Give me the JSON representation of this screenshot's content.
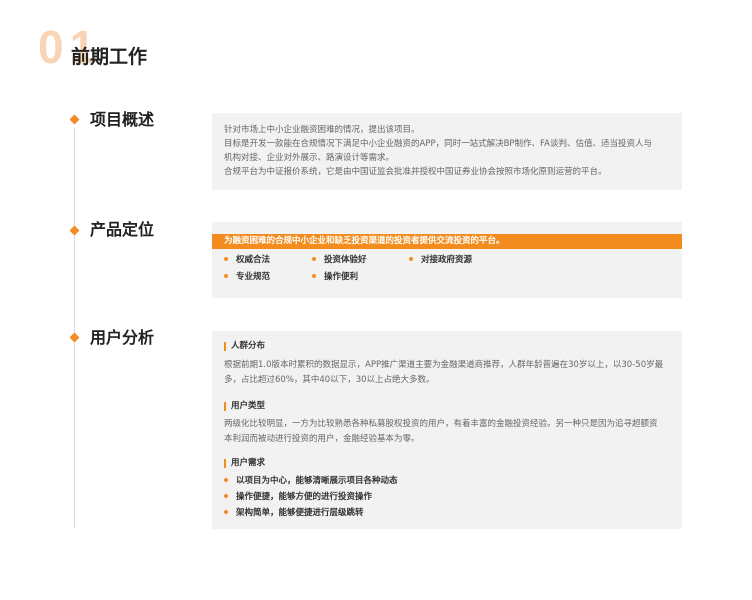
{
  "header": {
    "number": "01",
    "title": "前期工作"
  },
  "sections": {
    "overview": {
      "title": "项目概述",
      "lines": [
        "针对市场上中小企业融资困难的情况，提出该项目。",
        "目标是开发一款能在合规情况下满足中小企业融资的APP，同时一站式解决BP制作、FA谈判、估值、适当投资人与",
        "机构对接、企业对外展示、路演设计等需求。",
        "合规平台为中证报价系统，它是由中国证监会批准并授权中国证券业协会按照市场化原则运营的平台。"
      ]
    },
    "positioning": {
      "title": "产品定位",
      "banner": "为融资困难的合规中小企业和缺乏投资渠道的投资者提供交流投资的平台。",
      "bullets": [
        "权威合法",
        "投资体验好",
        "对接政府资源",
        "专业规范",
        "操作便利"
      ]
    },
    "analysis": {
      "title": "用户分析",
      "crowd_title": "人群分布",
      "crowd_lines": [
        "根据前期1.0版本时累积的数据显示，APP推广渠道主要为金融渠道商推荐，人群年龄普遍在30岁以上，以30-50岁最",
        "多，占比超过60%，其中40以下，30以上占绝大多数。"
      ],
      "type_title": "用户类型",
      "type_lines": [
        "两级化比较明显，一方为比较熟悉各种私募股权投资的用户，有着丰富的金融投资经验。另一种只是因为追寻超额资",
        "本利润而被动进行投资的用户，金融经验基本为零。"
      ],
      "needs_title": "用户需求",
      "needs": [
        "以项目为中心，能够清晰展示项目各种动态",
        "操作便捷，能够方便的进行投资操作",
        "架构简单，能够便捷进行层级跳转"
      ]
    }
  },
  "colors": {
    "accent": "#f28c1e",
    "number": "#f9d5b6",
    "card": "#f2f2f2"
  }
}
